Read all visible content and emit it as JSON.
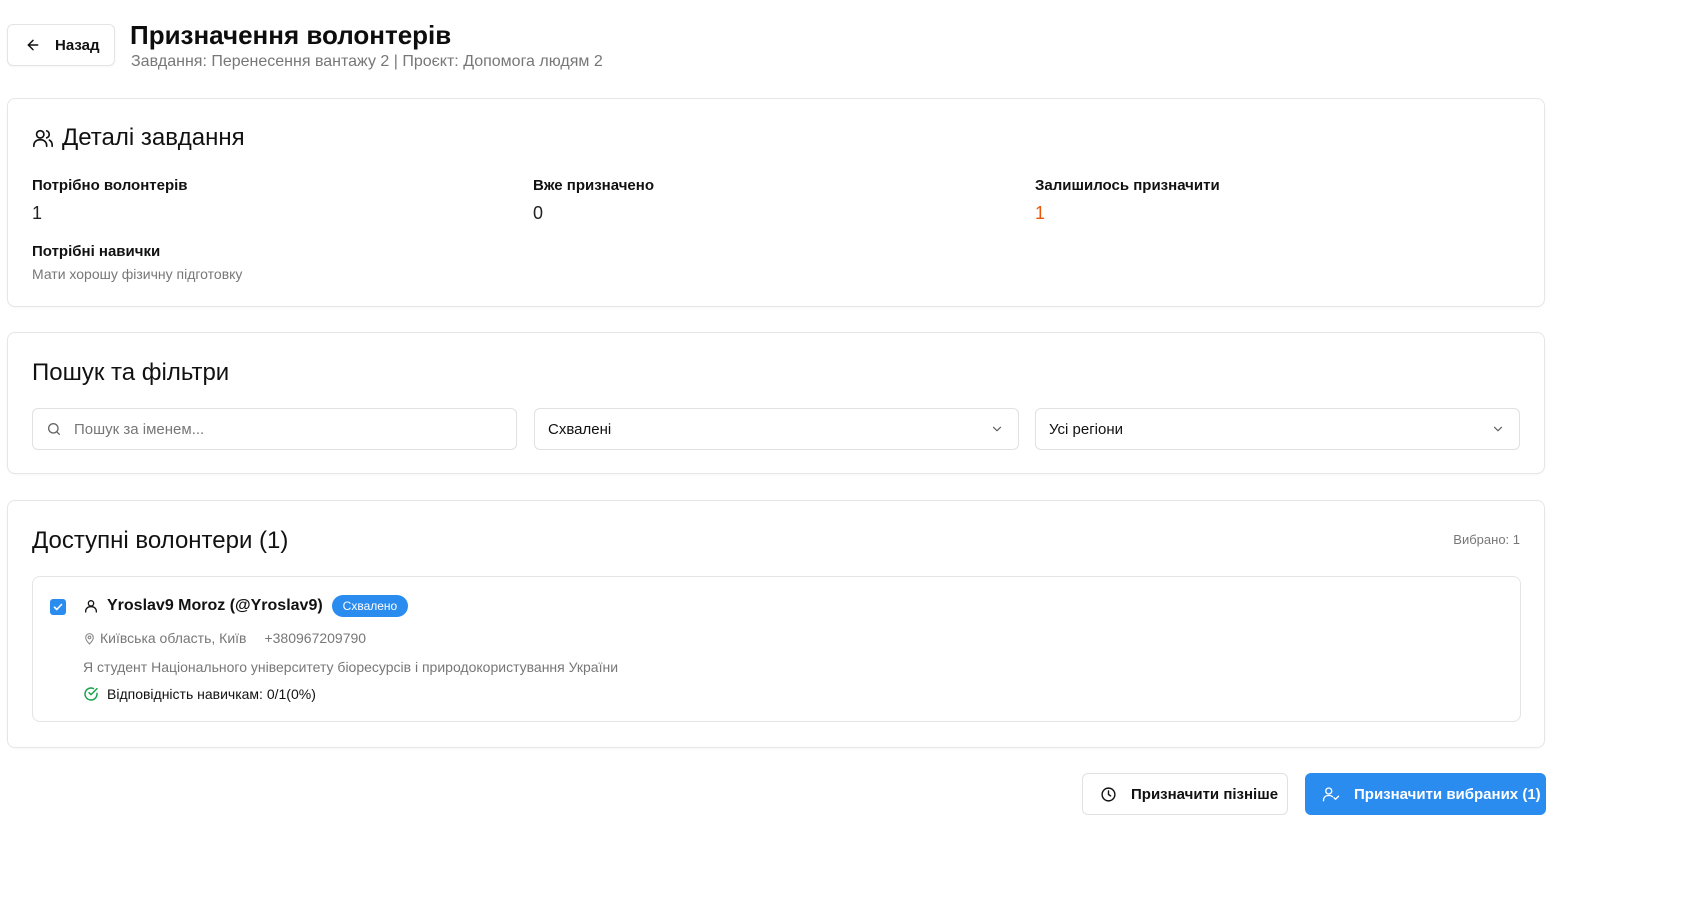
{
  "header": {
    "back_label": "Назад",
    "title": "Призначення волонтерів",
    "subtitle": "Завдання: Перенесення вантажу 2 | Проєкт: Допомога людям 2"
  },
  "details": {
    "title": "Деталі завдання",
    "icon": "users-icon",
    "needed_label": "Потрібно волонтерів",
    "needed_value": "1",
    "assigned_label": "Вже призначено",
    "assigned_value": "0",
    "remaining_label": "Залишилось призначити",
    "remaining_value": "1",
    "skills_label": "Потрібні навички",
    "skills_value": "Мати хорошу фізичну підготовку"
  },
  "filters": {
    "title": "Пошук та фільтри",
    "search_placeholder": "Пошук за іменем...",
    "status_value": "Схвалені",
    "region_value": "Усі регіони"
  },
  "volunteers": {
    "title": "Доступні волонтери (1)",
    "selected_text": "Вибрано: 1",
    "items": [
      {
        "selected": true,
        "name": "Yroslav9 Moroz (@Yroslav9)",
        "status": "Схвалено",
        "location": "Київська область, Київ",
        "phone": "+380967209790",
        "bio": "Я студент Національного університету біоресурсів і природокористування України",
        "skills_match": "Відповідність навичкам: 0/1(0%)"
      }
    ]
  },
  "actions": {
    "assign_later": "Призначити пізніше",
    "assign_selected": "Призначити вибраних (1)"
  },
  "colors": {
    "accent_blue": "#2b8cf0",
    "remaining_orange": "#ea580c",
    "match_green": "#16a34a"
  }
}
